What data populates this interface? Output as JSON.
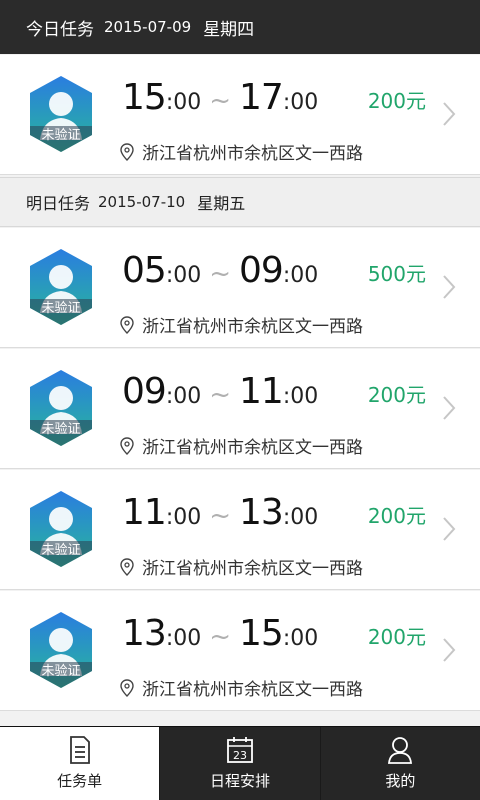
{
  "header": {
    "title": "今日任务",
    "date": "2015-07-09",
    "weekday": "星期四"
  },
  "sections": [
    {
      "title": "今日任务",
      "date": "2015-07-09",
      "weekday": "星期四",
      "tasks": [
        {
          "start_h": "15",
          "start_m": ":00",
          "end_h": "17",
          "end_m": ":00",
          "price": "200元",
          "location": "浙江省杭州市余杭区文一西路",
          "badge": "未验证"
        }
      ]
    },
    {
      "title": "明日任务",
      "date": "2015-07-10",
      "weekday": "星期五",
      "tasks": [
        {
          "start_h": "05",
          "start_m": ":00",
          "end_h": "09",
          "end_m": ":00",
          "price": "500元",
          "location": "浙江省杭州市余杭区文一西路",
          "badge": "未验证"
        },
        {
          "start_h": "09",
          "start_m": ":00",
          "end_h": "11",
          "end_m": ":00",
          "price": "200元",
          "location": "浙江省杭州市余杭区文一西路",
          "badge": "未验证"
        },
        {
          "start_h": "11",
          "start_m": ":00",
          "end_h": "13",
          "end_m": ":00",
          "price": "200元",
          "location": "浙江省杭州市余杭区文一西路",
          "badge": "未验证"
        },
        {
          "start_h": "13",
          "start_m": ":00",
          "end_h": "15",
          "end_m": ":00",
          "price": "200元",
          "location": "浙江省杭州市余杭区文一西路",
          "badge": "未验证"
        }
      ]
    }
  ],
  "tabbar": {
    "items": [
      {
        "label": "任务单",
        "icon": "document-icon",
        "active": true
      },
      {
        "label": "日程安排",
        "icon": "calendar-icon",
        "calendar_day": "23",
        "active": false
      },
      {
        "label": "我的",
        "icon": "user-icon",
        "active": false
      }
    ]
  },
  "colors": {
    "price": "#21a56b",
    "header_bg": "#2b2b2b",
    "tabbar_bg": "#262626"
  }
}
